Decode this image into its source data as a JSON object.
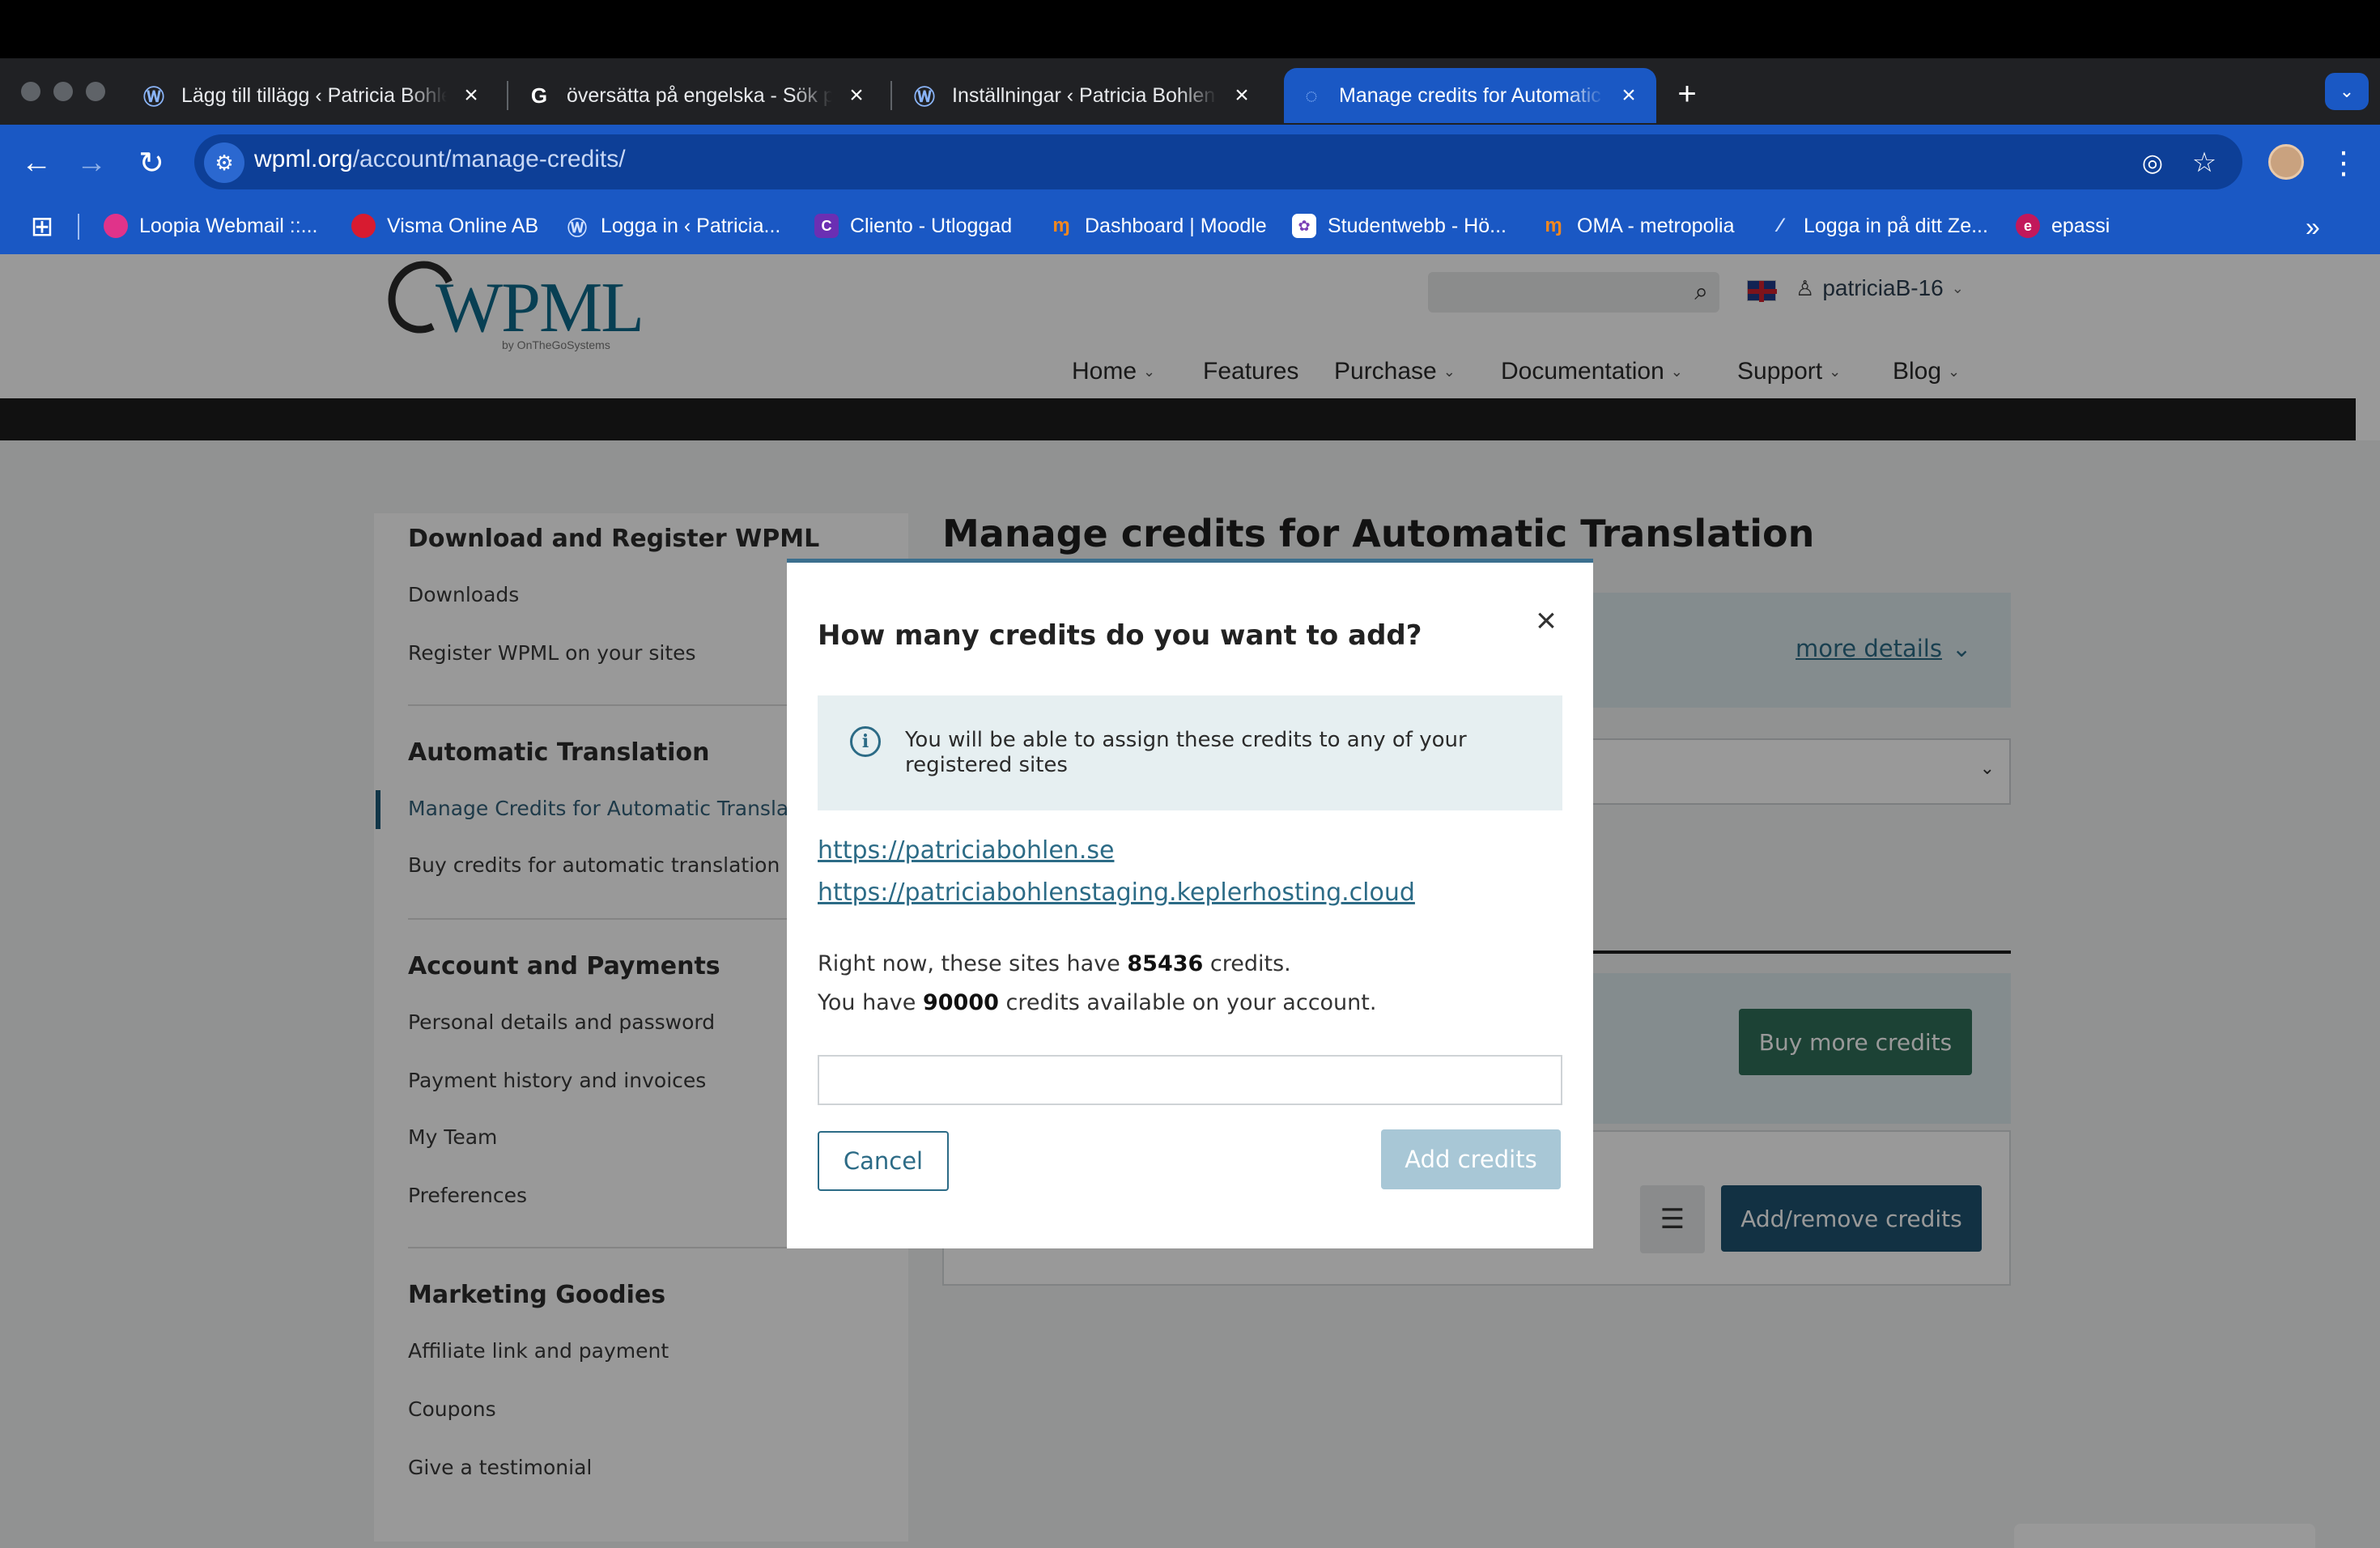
{
  "browser": {
    "tabs": [
      {
        "title": "Lägg till tillägg ‹ Patricia Bohlen"
      },
      {
        "title": "översätta på engelska - Sök på Google"
      },
      {
        "title": "Inställningar ‹ Patricia Bohlen"
      },
      {
        "title": "Manage credits for Automatic Translation"
      }
    ],
    "new_tab_label": "+",
    "url_domain": "wpml.org",
    "url_path": "/account/manage-credits/",
    "bookmarks": [
      {
        "label": "Loopia Webmail ::...",
        "color": "#e0338a"
      },
      {
        "label": "Visma Online AB",
        "color": "#d81b30"
      },
      {
        "label": "Logga in ‹ Patricia...",
        "color": "#1a58c4"
      },
      {
        "label": "Cliento - Utloggad",
        "color": "#6b2fb3"
      },
      {
        "label": "Dashboard | Moodle",
        "color": "#f2871f"
      },
      {
        "label": "Studentwebb - Hö...",
        "color": "#7a3fb6"
      },
      {
        "label": "OMA - metropolia",
        "color": "#f2871f"
      },
      {
        "label": "Logga in på ditt Ze...",
        "color": "#2d6cdf"
      },
      {
        "label": "epassi",
        "color": "#c2185b"
      }
    ]
  },
  "site": {
    "logo_text": "WPML",
    "logo_by": "by OnTheGoSystems",
    "username": "patriciaB-16",
    "nav": [
      "Home",
      "Features",
      "Purchase",
      "Documentation",
      "Support",
      "Blog"
    ],
    "nav_has_caret": [
      true,
      false,
      true,
      true,
      true,
      true
    ]
  },
  "sidebar": {
    "sections": [
      {
        "heading": "Download and Register WPML",
        "items": [
          "Downloads",
          "Register WPML on your sites"
        ]
      },
      {
        "heading": "Automatic Translation",
        "items": [
          "Manage Credits for Automatic Translation",
          "Buy credits for automatic translation"
        ]
      },
      {
        "heading": "Account and Payments",
        "items": [
          "Personal details and password",
          "Payment history and invoices",
          "My Team",
          "Preferences"
        ]
      },
      {
        "heading": "Marketing Goodies",
        "items": [
          "Affiliate link and payment",
          "Coupons",
          "Give a testimonial"
        ]
      }
    ],
    "active_item": "Manage Credits for Automatic Translation"
  },
  "main": {
    "title": "Manage credits for Automatic Translation",
    "more_details": "more details",
    "buy_more_credits": "Buy more credits",
    "add_remove_credits": "Add/remove credits"
  },
  "modal": {
    "title": "How many credits do you want to add?",
    "notice": "You will be able to assign these credits to any of your registered sites",
    "sites": [
      "https://patriciabohlen.se",
      "https://patriciabohlenstaging.keplerhosting.cloud"
    ],
    "sites_credits_prefix": "Right now, these sites have",
    "sites_credits_value": "85436",
    "sites_credits_suffix": "credits.",
    "account_credits_prefix": "You have",
    "account_credits_value": "90000",
    "account_credits_suffix": "credits available on your account.",
    "amount_value": "",
    "cancel_label": "Cancel",
    "add_label": "Add credits"
  }
}
